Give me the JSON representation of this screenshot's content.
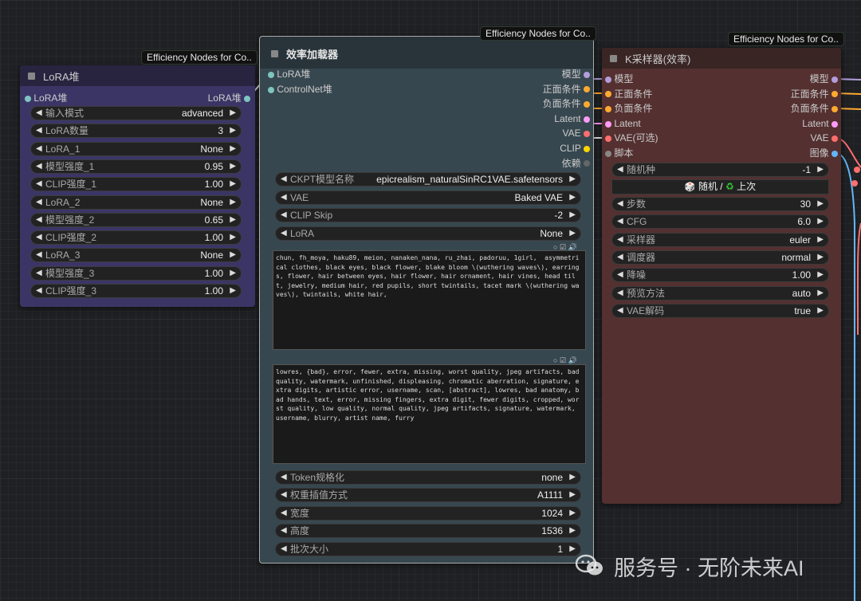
{
  "badges": {
    "b1": "Efficiency Nodes for Co..",
    "b2": "Efficiency Nodes for Co..",
    "b3": "Efficiency Nodes for Co.."
  },
  "lora_node": {
    "title": "LoRA堆",
    "input": "LoRA堆",
    "output": "LoRA堆",
    "widgets": [
      {
        "label": "输入模式",
        "value": "advanced"
      },
      {
        "label": "LoRA数量",
        "value": "3"
      },
      {
        "label": "LoRA_1",
        "value": "None"
      },
      {
        "label": "模型强度_1",
        "value": "0.95"
      },
      {
        "label": "CLIP强度_1",
        "value": "1.00"
      },
      {
        "label": "LoRA_2",
        "value": "None"
      },
      {
        "label": "模型强度_2",
        "value": "0.65"
      },
      {
        "label": "CLIP强度_2",
        "value": "1.00"
      },
      {
        "label": "LoRA_3",
        "value": "None"
      },
      {
        "label": "模型强度_3",
        "value": "1.00"
      },
      {
        "label": "CLIP强度_3",
        "value": "1.00"
      }
    ]
  },
  "loader_node": {
    "title": "效率加载器",
    "inputs": [
      "LoRA堆",
      "ControlNet堆"
    ],
    "outputs": [
      "模型",
      "正面条件",
      "负面条件",
      "Latent",
      "VAE",
      "CLIP",
      "依赖"
    ],
    "widgets_top": [
      {
        "label": "CKPT模型名称",
        "value": "epicrealism_naturalSinRC1VAE.safetensors"
      },
      {
        "label": "VAE",
        "value": "Baked VAE"
      },
      {
        "label": "CLIP Skip",
        "value": "-2"
      },
      {
        "label": "LoRA",
        "value": "None"
      }
    ],
    "positive_prompt": "chun, fh_moya, haku89, meion, nanaken_nana, ru_zhai, padoruu, 1girl,  asymmetrical clothes, black eyes, black flower, blake bloom \\(wuthering waves\\), earrings, flower, hair between eyes, hair flower, hair ornament, hair vines, head tilt, jewelry, medium hair, red pupils, short twintails, tacet mark \\(wuthering waves\\), twintails, white hair,",
    "negative_prompt": "lowres, {bad}, error, fewer, extra, missing, worst quality, jpeg artifacts, bad quality, watermark, unfinished, displeasing, chromatic aberration, signature, extra digits, artistic error, username, scan, [abstract], lowres, bad anatomy, bad hands, text, error, missing fingers, extra digit, fewer digits, cropped, worst quality, low quality, normal quality, jpeg artifacts, signature, watermark, username, blurry, artist name, furry",
    "widgets_bottom": [
      {
        "label": "Token规格化",
        "value": "none"
      },
      {
        "label": "权重插值方式",
        "value": "A1111"
      },
      {
        "label": "宽度",
        "value": "1024"
      },
      {
        "label": "高度",
        "value": "1536"
      },
      {
        "label": "批次大小",
        "value": "1"
      }
    ]
  },
  "ksampler_node": {
    "title": "K采样器(效率)",
    "inputs": [
      "模型",
      "正面条件",
      "负面条件",
      "Latent",
      "VAE(可选)",
      "脚本"
    ],
    "outputs": [
      "模型",
      "正面条件",
      "负面条件",
      "Latent",
      "VAE",
      "图像"
    ],
    "seed": {
      "label": "随机种",
      "value": "-1"
    },
    "seed_buttons": {
      "random": "随机 /",
      "last": "上次"
    },
    "widgets": [
      {
        "label": "步数",
        "value": "30"
      },
      {
        "label": "CFG",
        "value": "6.0"
      },
      {
        "label": "采样器",
        "value": "euler"
      },
      {
        "label": "调度器",
        "value": "normal"
      },
      {
        "label": "降噪",
        "value": "1.00"
      },
      {
        "label": "预览方法",
        "value": "auto"
      },
      {
        "label": "VAE解码",
        "value": "true"
      }
    ]
  },
  "watermark": "服务号 · 无阶未来AI",
  "colors": {
    "model": "#b39ddb",
    "conditioning": "#ffa931",
    "latent": "#ff9cf9",
    "vae": "#ff6e6e",
    "clip": "#ffd500",
    "image": "#64b5f6",
    "lora": "#7fc4c0"
  }
}
